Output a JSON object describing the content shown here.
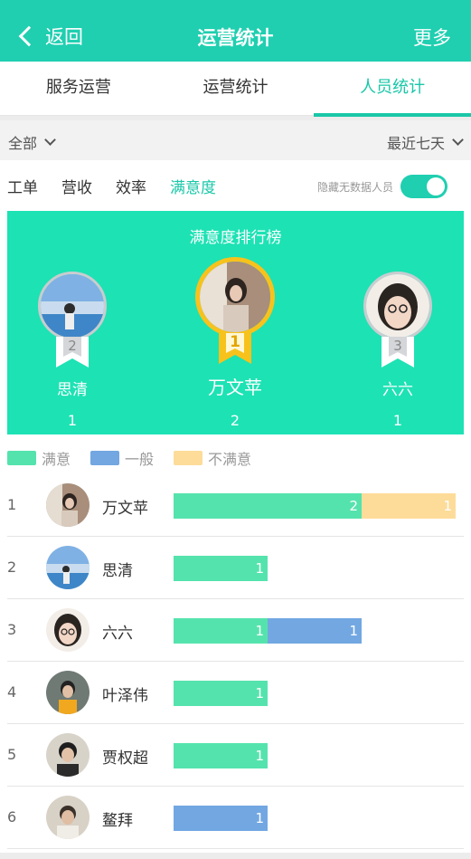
{
  "header": {
    "back_label": "返回",
    "title": "运营统计",
    "more_label": "更多"
  },
  "tabs": [
    {
      "label": "服务运营",
      "active": false
    },
    {
      "label": "运营统计",
      "active": false
    },
    {
      "label": "人员统计",
      "active": true
    }
  ],
  "filters": {
    "scope": "全部",
    "range": "最近七天"
  },
  "subtabs": [
    {
      "label": "工单",
      "active": false
    },
    {
      "label": "营收",
      "active": false
    },
    {
      "label": "效率",
      "active": false
    },
    {
      "label": "满意度",
      "active": true
    }
  ],
  "hide_no_data": {
    "label": "隐藏无数据人员",
    "on": true
  },
  "podium": {
    "title": "满意度排行榜",
    "first": {
      "rank": "1",
      "name": "万文苹",
      "count": "2"
    },
    "second": {
      "rank": "2",
      "name": "思清",
      "count": "1"
    },
    "third": {
      "rank": "3",
      "name": "六六",
      "count": "1"
    }
  },
  "legend": [
    {
      "label": "满意",
      "color": "#55e3ad"
    },
    {
      "label": "一般",
      "color": "#72a7e2"
    },
    {
      "label": "不满意",
      "color": "#fddc9a"
    }
  ],
  "chart_data": {
    "type": "bar",
    "stacked": true,
    "orientation": "horizontal",
    "categories": [
      "万文苹",
      "思清",
      "六六",
      "叶泽伟",
      "贾权超",
      "鳌拜"
    ],
    "series": [
      {
        "name": "满意",
        "values": [
          2,
          1,
          1,
          1,
          1,
          0
        ]
      },
      {
        "name": "一般",
        "values": [
          0,
          0,
          1,
          0,
          0,
          1
        ]
      },
      {
        "name": "不满意",
        "values": [
          1,
          0,
          0,
          0,
          0,
          0
        ]
      }
    ]
  },
  "ranking": [
    {
      "rank": "1",
      "name": "万文苹"
    },
    {
      "rank": "2",
      "name": "思清"
    },
    {
      "rank": "3",
      "name": "六六"
    },
    {
      "rank": "4",
      "name": "叶泽伟"
    },
    {
      "rank": "5",
      "name": "贾权超"
    },
    {
      "rank": "6",
      "name": "鳌拜"
    }
  ]
}
